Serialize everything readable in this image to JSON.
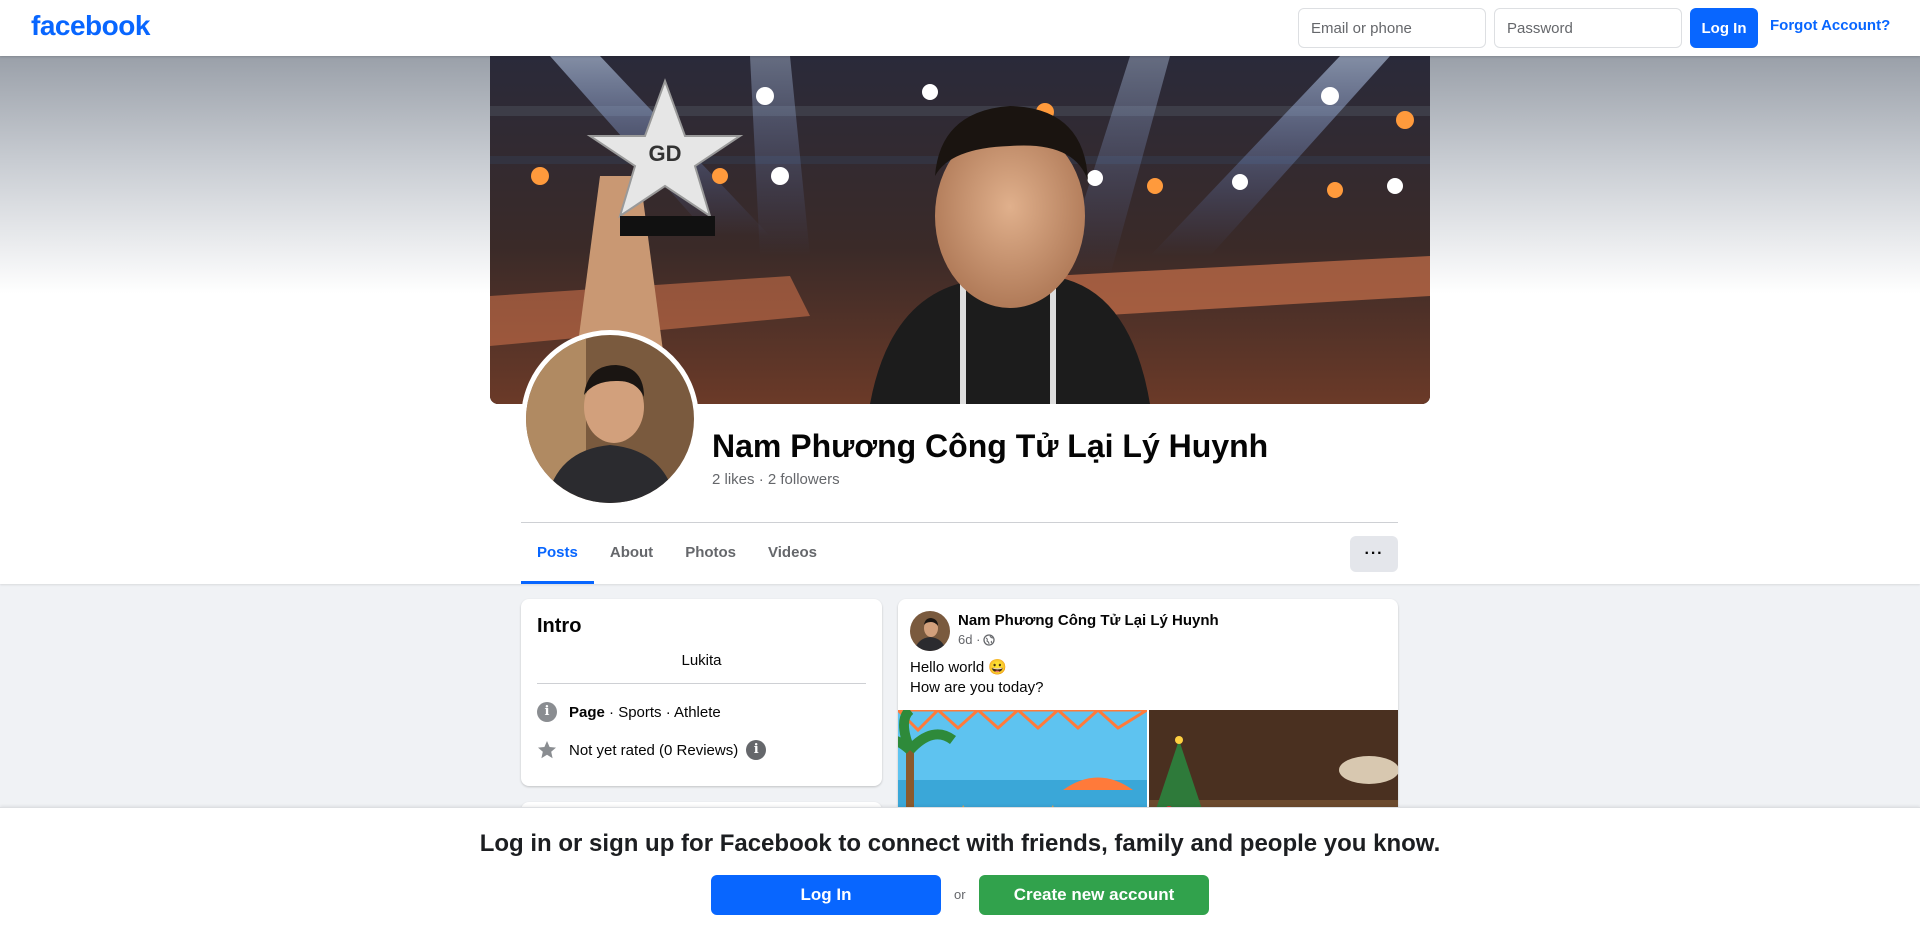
{
  "header": {
    "logo": "facebook",
    "email_placeholder": "Email or phone",
    "password_placeholder": "Password",
    "login_label": "Log In",
    "forgot_label": "Forgot Account?"
  },
  "profile": {
    "name": "Nam Phương Công Tử Lại Lý Huynh",
    "likes": "2 likes",
    "separator": "·",
    "followers": "2 followers"
  },
  "tabs": [
    {
      "label": "Posts",
      "active": true
    },
    {
      "label": "About",
      "active": false
    },
    {
      "label": "Photos",
      "active": false
    },
    {
      "label": "Videos",
      "active": false
    }
  ],
  "more_label": "···",
  "intro": {
    "title": "Intro",
    "bio": "Lukita",
    "category_bold": "Page",
    "category_rest": " · Sports · Athlete",
    "rating": "Not yet rated (0 Reviews)"
  },
  "post": {
    "author": "Nam Phương Công Tử Lại Lý Huynh",
    "time": "6d ·",
    "line1": "Hello world 😀",
    "line2": "How are you today?"
  },
  "banner": {
    "headline": "Log in or sign up for Facebook to connect with friends, family and people you know.",
    "login_label": "Log In",
    "or": "or",
    "create_label": "Create new account"
  },
  "colors": {
    "brand": "#0866ff",
    "create": "#31a24c",
    "background": "#f0f2f5"
  }
}
